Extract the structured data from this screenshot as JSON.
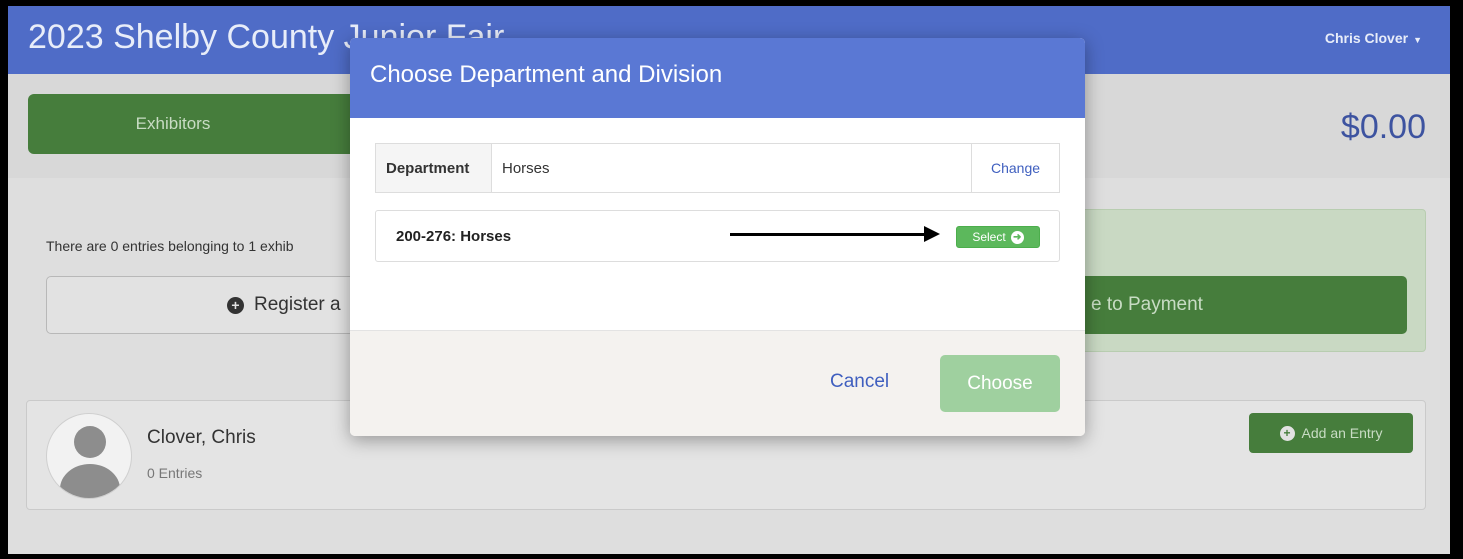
{
  "app": {
    "title": "2023 Shelby County Junior Fair",
    "user_name": "Chris Clover"
  },
  "subbar": {
    "exhibitors_label": "Exhibitors",
    "total": "$0.00"
  },
  "content": {
    "info_text": "There are 0 entries belonging to 1 exhib",
    "register_label": "Register a",
    "payment_label": "e to Payment"
  },
  "exhibitor": {
    "name": "Clover, Chris",
    "entries": "0 Entries",
    "add_entry_label": "Add an Entry"
  },
  "modal": {
    "title": "Choose Department and Division",
    "department_label": "Department",
    "department_value": "Horses",
    "change_label": "Change",
    "division_name": "200-276: Horses",
    "select_label": "Select",
    "cancel_label": "Cancel",
    "choose_label": "Choose"
  },
  "colors": {
    "navbar": "#4f6cc7",
    "primary_green": "#467d3c",
    "modal_header": "#5a78d4",
    "select_green": "#5cb85c",
    "link_blue": "#3f5fbf"
  },
  "icons": {
    "caret": "caret-down-icon",
    "plus": "plus-circle-icon",
    "arrow": "arrow-right-circle-icon"
  }
}
